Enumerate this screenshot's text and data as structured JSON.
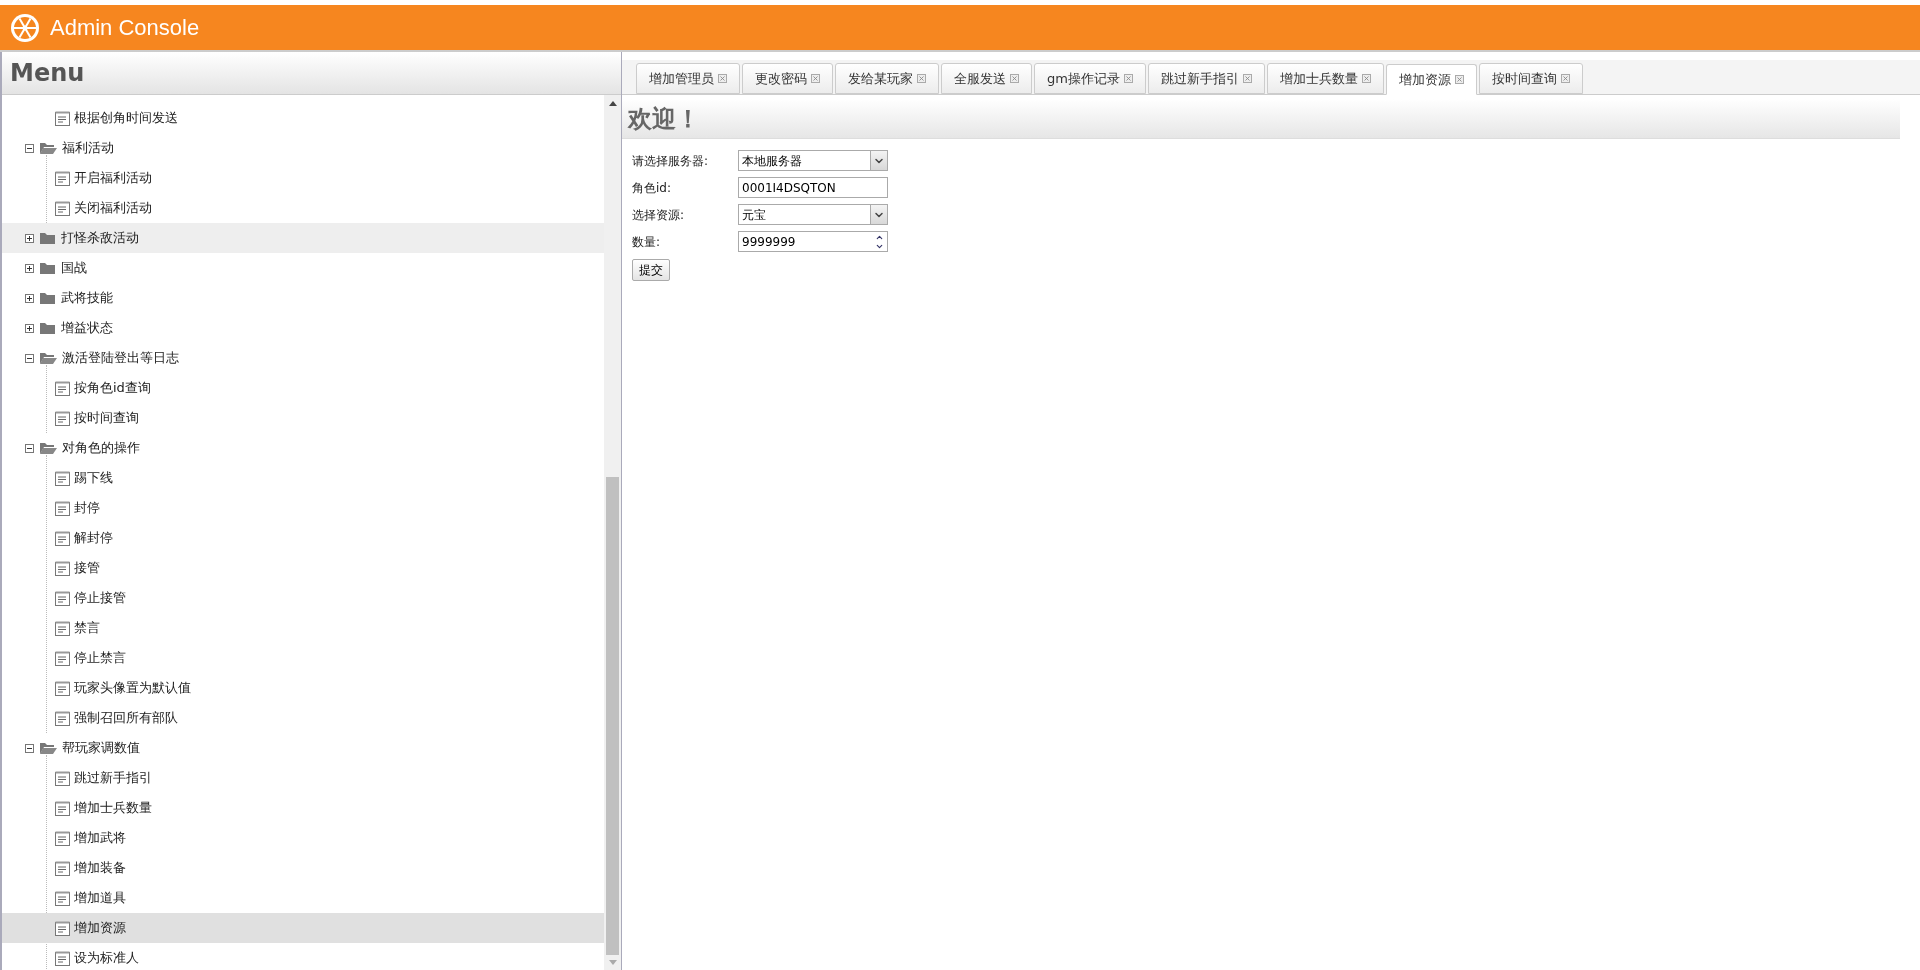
{
  "header": {
    "title": "Admin Console"
  },
  "menu": {
    "title": "Menu",
    "tree_continued": [
      {
        "label": "根据创角时间发送",
        "selected": false,
        "hovered": false
      }
    ],
    "tree": [
      {
        "label": "福利活动",
        "expanded": true,
        "hovered": false,
        "children": [
          {
            "label": "开启福利活动",
            "selected": false,
            "hovered": false
          },
          {
            "label": "关闭福利活动",
            "selected": false,
            "hovered": false
          }
        ]
      },
      {
        "label": "打怪杀敌活动",
        "expanded": false,
        "hovered": true
      },
      {
        "label": "国战",
        "expanded": false,
        "hovered": false
      },
      {
        "label": "武将技能",
        "expanded": false,
        "hovered": false
      },
      {
        "label": "增益状态",
        "expanded": false,
        "hovered": false
      },
      {
        "label": "激活登陆登出等日志",
        "expanded": true,
        "hovered": false,
        "children": [
          {
            "label": "按角色id查询",
            "selected": false,
            "hovered": false
          },
          {
            "label": "按时间查询",
            "selected": false,
            "hovered": false
          }
        ]
      },
      {
        "label": "对角色的操作",
        "expanded": true,
        "hovered": false,
        "children": [
          {
            "label": "踢下线",
            "selected": false,
            "hovered": false
          },
          {
            "label": "封停",
            "selected": false,
            "hovered": false
          },
          {
            "label": "解封停",
            "selected": false,
            "hovered": false
          },
          {
            "label": "接管",
            "selected": false,
            "hovered": false
          },
          {
            "label": "停止接管",
            "selected": false,
            "hovered": false
          },
          {
            "label": "禁言",
            "selected": false,
            "hovered": false
          },
          {
            "label": "停止禁言",
            "selected": false,
            "hovered": false
          },
          {
            "label": "玩家头像置为默认值",
            "selected": false,
            "hovered": false
          },
          {
            "label": "强制召回所有部队",
            "selected": false,
            "hovered": false
          }
        ]
      },
      {
        "label": "帮玩家调数值",
        "expanded": true,
        "hovered": false,
        "children": [
          {
            "label": "跳过新手指引",
            "selected": false,
            "hovered": false
          },
          {
            "label": "增加士兵数量",
            "selected": false,
            "hovered": false
          },
          {
            "label": "增加武将",
            "selected": false,
            "hovered": false
          },
          {
            "label": "增加装备",
            "selected": false,
            "hovered": false
          },
          {
            "label": "增加道具",
            "selected": false,
            "hovered": false
          },
          {
            "label": "增加资源",
            "selected": true,
            "hovered": false
          },
          {
            "label": "设为标准人",
            "selected": false,
            "hovered": false
          }
        ]
      }
    ]
  },
  "tabs": [
    {
      "label": "增加管理员",
      "selected": false
    },
    {
      "label": "更改密码",
      "selected": false
    },
    {
      "label": "发给某玩家",
      "selected": false
    },
    {
      "label": "全服发送",
      "selected": false
    },
    {
      "label": "gm操作记录",
      "selected": false
    },
    {
      "label": "跳过新手指引",
      "selected": false
    },
    {
      "label": "增加士兵数量",
      "selected": false
    },
    {
      "label": "增加资源",
      "selected": true
    },
    {
      "label": "按时间查询",
      "selected": false
    }
  ],
  "panel": {
    "title": "欢迎！",
    "fields": [
      {
        "kind": "select",
        "label": "请选择服务器:",
        "value": "本地服务器"
      },
      {
        "kind": "text",
        "label": "角色id:",
        "value": "0001I4DSQTON"
      },
      {
        "kind": "select",
        "label": "选择资源:",
        "value": "元宝"
      },
      {
        "kind": "number",
        "label": "数量:",
        "value": "9999999"
      }
    ],
    "submit": "提交"
  }
}
